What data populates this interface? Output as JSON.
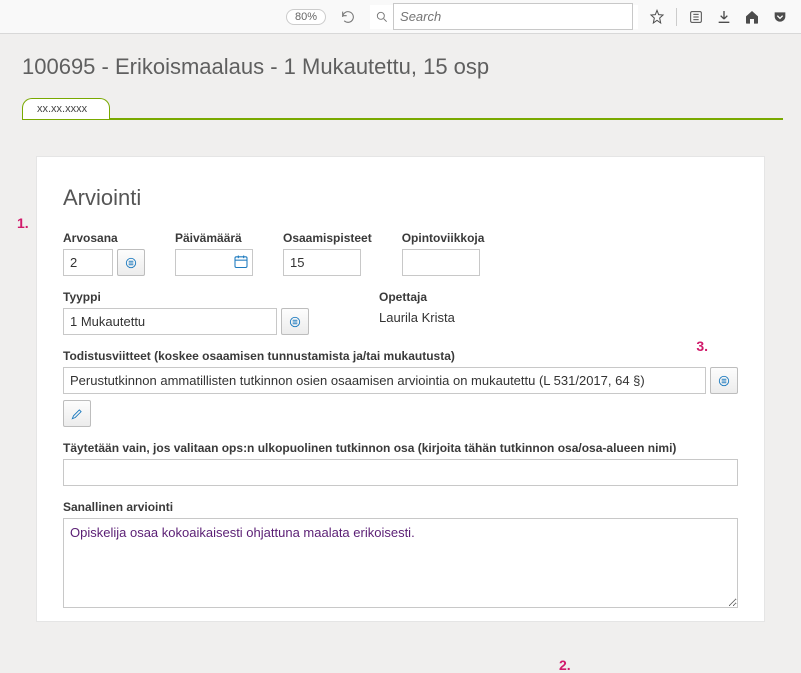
{
  "browser": {
    "zoom": "80%",
    "search_placeholder": "Search"
  },
  "page": {
    "title": "100695 - Erikoismaalaus - 1 Mukautettu, 15 osp",
    "tab_label": "xx.xx.xxxx"
  },
  "arviointi": {
    "heading": "Arviointi",
    "arvosana": {
      "label": "Arvosana",
      "value": "2"
    },
    "paivamaara": {
      "label": "Päivämäärä",
      "value": ""
    },
    "osaamispisteet": {
      "label": "Osaamispisteet",
      "value": "15"
    },
    "opintoviikkoja": {
      "label": "Opintoviikkoja",
      "value": ""
    },
    "tyyppi": {
      "label": "Tyyppi",
      "value": "1 Mukautettu"
    },
    "opettaja": {
      "label": "Opettaja",
      "value": "Laurila Krista"
    },
    "todistusviitteet": {
      "label": "Todistusviitteet (koskee osaamisen tunnustamista ja/tai mukautusta)",
      "value": "Perustutkinnon ammatillisten tutkinnon osien osaamisen arviointia on mukautettu (L 531/2017, 64 §)"
    },
    "ops_ulkopuolinen": {
      "label": "Täytetään vain, jos valitaan ops:n ulkopuolinen tutkinnon osa (kirjoita tähän tutkinnon osa/osa-alueen nimi)",
      "value": ""
    },
    "sanallinen": {
      "label": "Sanallinen arviointi",
      "value": "Opiskelija osaa kokoaikaisesti ohjattuna maalata erikoisesti."
    }
  },
  "annotations": {
    "a1": "1.",
    "a2": "2.",
    "a3": "3."
  }
}
